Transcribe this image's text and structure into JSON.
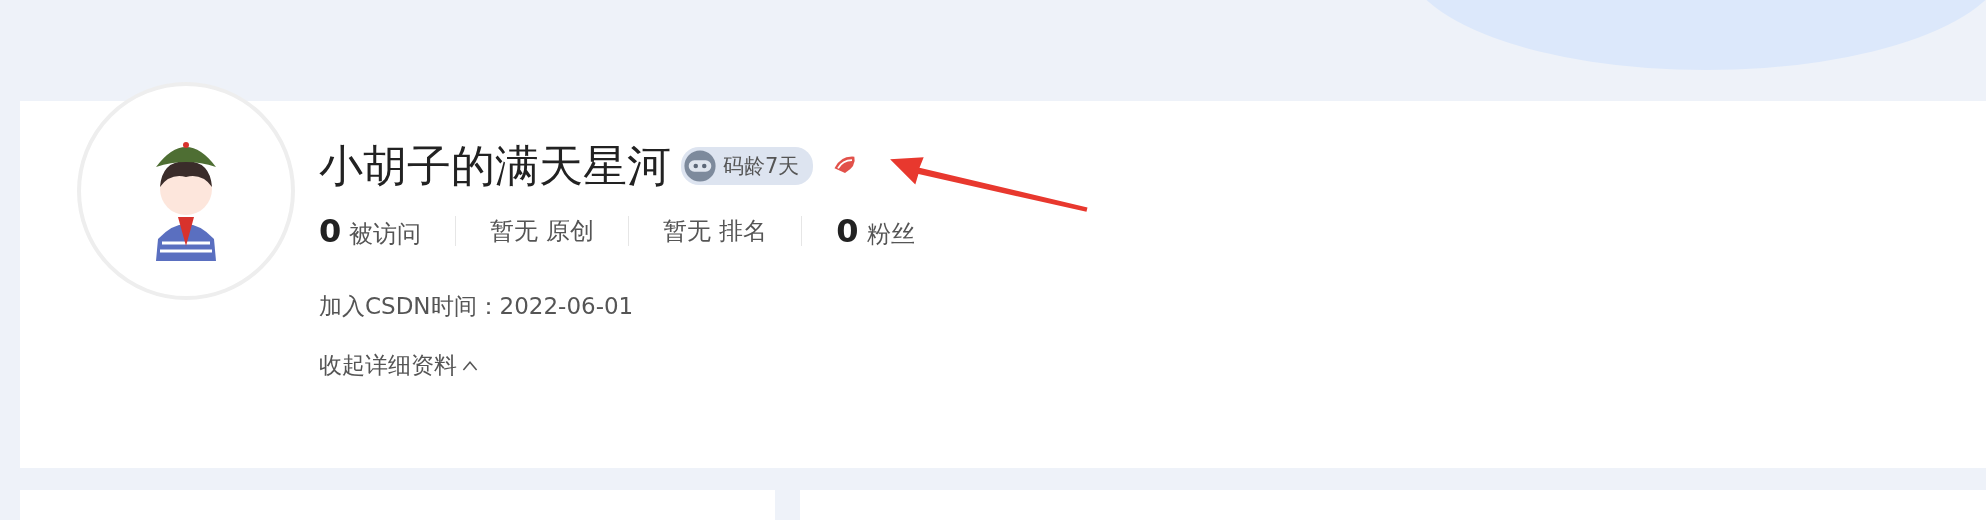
{
  "profile": {
    "name": "小胡子的满天星河",
    "badge": "码龄7天",
    "stats": [
      {
        "kind": "number",
        "value": "0",
        "label": "被访问"
      },
      {
        "kind": "text",
        "value": "暂无",
        "label": "原创"
      },
      {
        "kind": "text",
        "value": "暂无",
        "label": "排名"
      },
      {
        "kind": "number",
        "value": "0",
        "label": "粉丝"
      }
    ],
    "join_date": "加入CSDN时间：2022-06-01",
    "collapse_link": "收起详细资料"
  }
}
